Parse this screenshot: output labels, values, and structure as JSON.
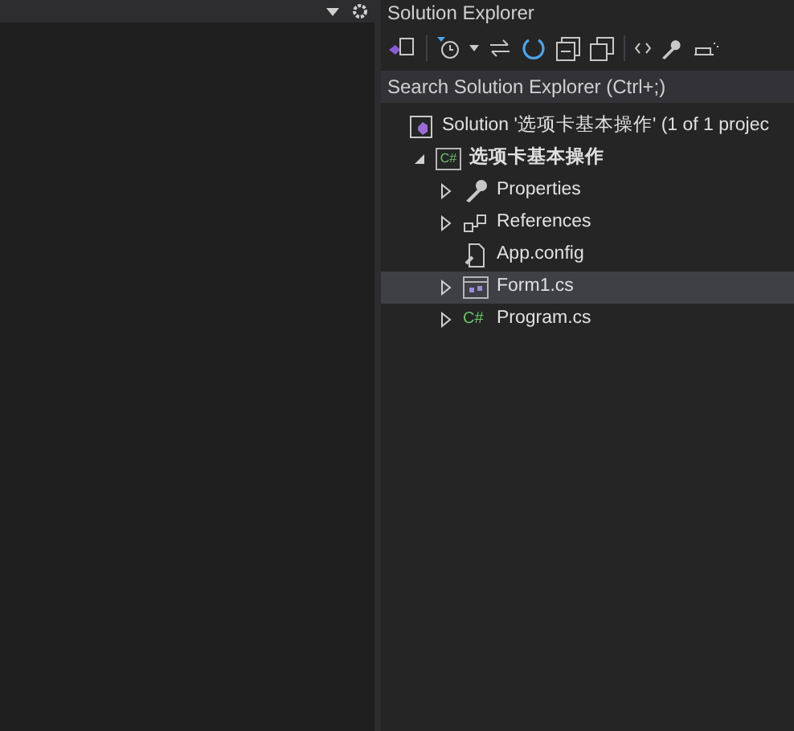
{
  "panel": {
    "title": "Solution Explorer"
  },
  "search": {
    "placeholder": "Search Solution Explorer (Ctrl+;)"
  },
  "tree": [
    {
      "label": "Solution '选项卡基本操作' (1 of 1 projec",
      "kind": "solution",
      "expandable": false,
      "selected": false,
      "bold": false,
      "children": [
        {
          "label": "选项卡基本操作",
          "kind": "project",
          "icon_text": "C#",
          "expandable": true,
          "expanded": true,
          "selected": false,
          "bold": true,
          "children": [
            {
              "label": "Properties",
              "kind": "properties",
              "expandable": true,
              "expanded": false,
              "selected": false,
              "bold": false
            },
            {
              "label": "References",
              "kind": "references",
              "expandable": true,
              "expanded": false,
              "selected": false,
              "bold": false
            },
            {
              "label": "App.config",
              "kind": "config",
              "expandable": false,
              "selected": false,
              "bold": false
            },
            {
              "label": "Form1.cs",
              "kind": "form",
              "expandable": true,
              "expanded": false,
              "selected": true,
              "bold": false
            },
            {
              "label": "Program.cs",
              "kind": "csharp",
              "icon_text": "C#",
              "expandable": true,
              "expanded": false,
              "selected": false,
              "bold": false
            }
          ]
        }
      ]
    }
  ]
}
